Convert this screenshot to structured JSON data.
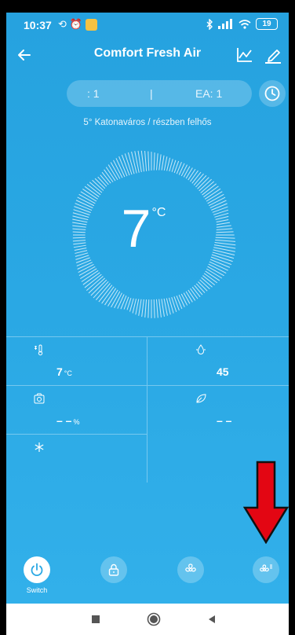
{
  "status_bar": {
    "time": "10:37",
    "battery": "19"
  },
  "header": {
    "title": "Comfort  Fresh Air"
  },
  "info_pill": {
    "left_text": ": 1",
    "separator": "|",
    "right_text": "EA:  1"
  },
  "weather": "5°  Katonaváros  /  részben felhős",
  "temperature": {
    "value": "7",
    "unit": "°C"
  },
  "metrics": [
    {
      "icon": "thermometer-fan-icon",
      "value": "7",
      "unit": "°C"
    },
    {
      "icon": "humidity-icon",
      "value": "45",
      "unit": ""
    },
    {
      "icon": "camera-sensor-icon",
      "value": "– –",
      "unit": "%"
    },
    {
      "icon": "leaf-icon",
      "value": "– –",
      "unit": ""
    },
    {
      "icon": "snowflake-icon",
      "value": "",
      "unit": ""
    }
  ],
  "controls": {
    "switch_label": "Switch"
  },
  "colors": {
    "background": "#2aa8e4",
    "accent_arrow": "#e30613"
  }
}
